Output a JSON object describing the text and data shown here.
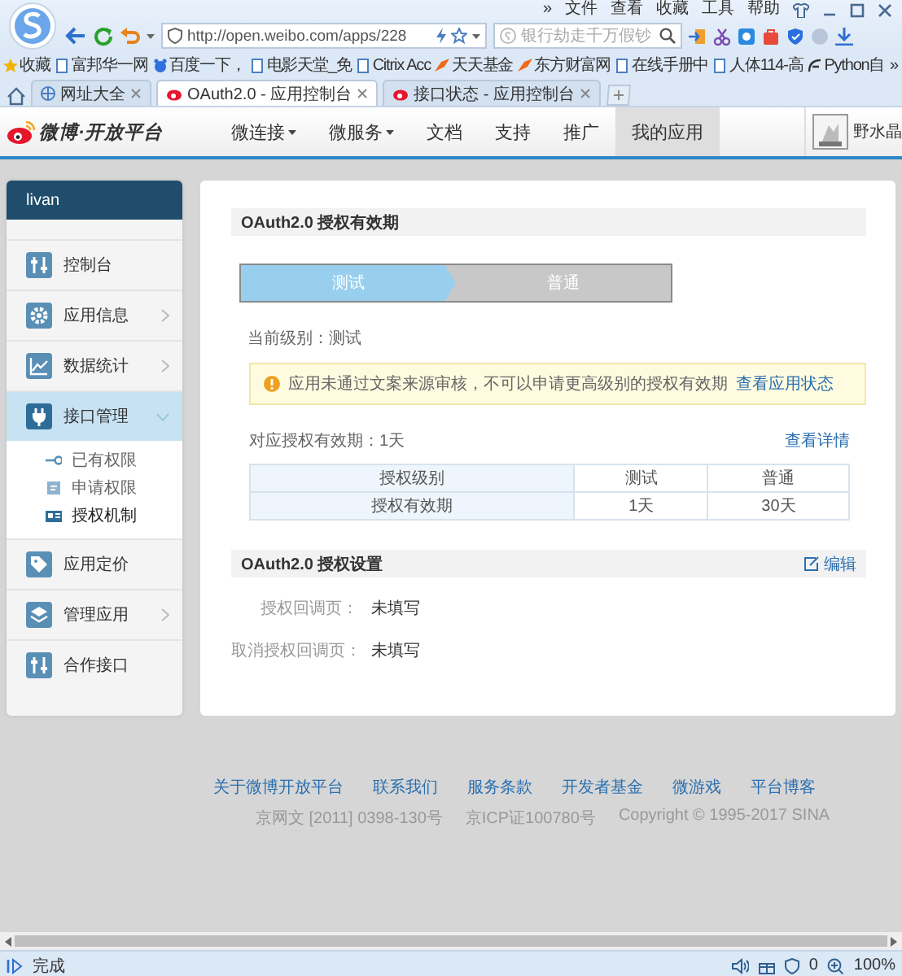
{
  "browser": {
    "menu": [
      "»",
      "文件",
      "查看",
      "收藏",
      "工具",
      "帮助"
    ],
    "address": "http://open.weibo.com/apps/228",
    "search": {
      "placeholder": "银行劫走千万假钞"
    },
    "bookmarks": [
      "收藏",
      "富邦华一网",
      "百度一下，",
      "电影天堂_免",
      "Citrix Acc",
      "天天基金",
      "东方财富网",
      "在线手册中",
      "人体114-高",
      "Python自"
    ],
    "bookmarks_more": "»",
    "tabs": [
      {
        "title": "网址大全",
        "selected": false
      },
      {
        "title": "OAuth2.0 - 应用控制台",
        "selected": true
      },
      {
        "title": "接口状态 - 应用控制台",
        "selected": false
      }
    ],
    "status": "完成",
    "blocked_count": "0",
    "zoom": "100%"
  },
  "site": {
    "logo": "微博·开放平台",
    "nav": [
      {
        "label": "微连接",
        "dropdown": true,
        "selected": false
      },
      {
        "label": "微服务",
        "dropdown": true,
        "selected": false
      },
      {
        "label": "文档",
        "dropdown": false,
        "selected": false
      },
      {
        "label": "支持",
        "dropdown": false,
        "selected": false
      },
      {
        "label": "推广",
        "dropdown": false,
        "selected": false
      },
      {
        "label": "我的应用",
        "dropdown": false,
        "selected": true
      }
    ],
    "user": "野水晶"
  },
  "sidebar": {
    "user": "livan",
    "items": [
      {
        "label": "控制台",
        "selected": false
      },
      {
        "label": "应用信息",
        "expanded": false,
        "selected": false
      },
      {
        "label": "数据统计",
        "expanded": false,
        "selected": false
      },
      {
        "label": "接口管理",
        "expanded": true,
        "selected": true,
        "children": [
          {
            "label": "已有权限",
            "selected": false
          },
          {
            "label": "申请权限",
            "selected": false
          },
          {
            "label": "授权机制",
            "selected": true
          }
        ]
      },
      {
        "label": "应用定价",
        "selected": false
      },
      {
        "label": "管理应用",
        "expanded": false,
        "selected": false
      },
      {
        "label": "合作接口",
        "selected": false
      }
    ]
  },
  "validity": {
    "title": "OAuth2.0 授权有效期",
    "steps": [
      {
        "label": "测试",
        "selected": true
      },
      {
        "label": "普通",
        "selected": false
      }
    ],
    "current_level": "当前级别：测试",
    "alert": {
      "text": "应用未通过文案来源审核，不可以申请更高级别的授权有效期",
      "link": "查看应用状态"
    },
    "period": "对应授权有效期：1天",
    "details_link": "查看详情",
    "table": {
      "rows": [
        [
          "授权级别",
          "测试",
          "普通"
        ],
        [
          "授权有效期",
          "1天",
          "30天"
        ]
      ]
    }
  },
  "settings": {
    "title": "OAuth2.0 授权设置",
    "edit": "编辑",
    "fields": [
      {
        "label": "授权回调页：",
        "value": "未填写"
      },
      {
        "label": "取消授权回调页：",
        "value": "未填写"
      }
    ]
  },
  "footer": {
    "links": [
      "关于微博开放平台",
      "联系我们",
      "服务条款",
      "开发者基金",
      "微游戏",
      "平台博客"
    ],
    "legal": [
      "京网文 [2011] 0398-130号",
      "京ICP证100780号",
      "Copyright © 1995-2017 SINA"
    ]
  }
}
